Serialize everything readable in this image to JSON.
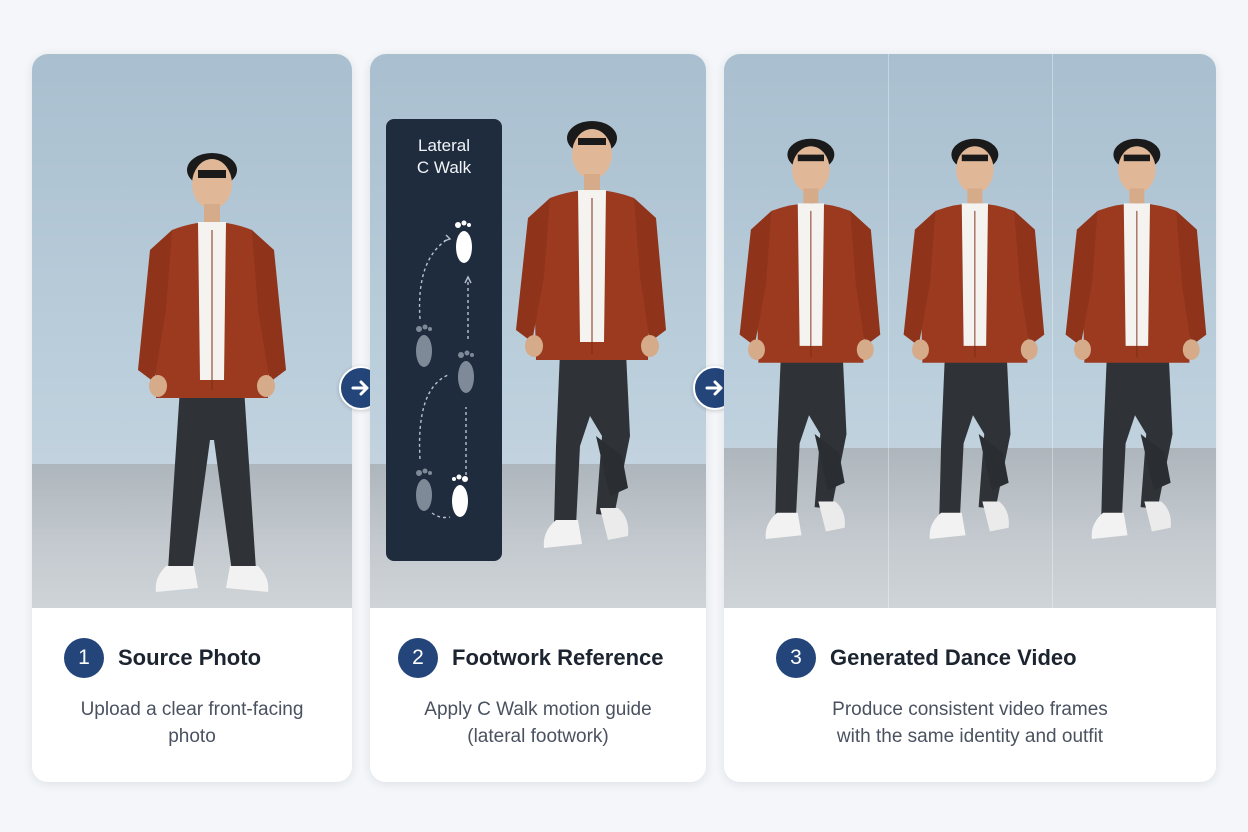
{
  "steps": [
    {
      "number": "1",
      "title": "Source Photo",
      "description": "Upload a clear front-facing photo"
    },
    {
      "number": "2",
      "title": "Footwork Reference",
      "description": "Apply C Walk motion guide (lateral footwork)"
    },
    {
      "number": "3",
      "title": "Generated Dance Video",
      "description": "Produce consistent video frames with the same identity and outfit"
    }
  ],
  "footwork": {
    "title": "Lateral\nC Walk"
  },
  "icons": {
    "flow_arrow": "arrow-right-icon",
    "footprint": "footprint-icon"
  },
  "colors": {
    "accent": "#24457a",
    "shirt": "#9b3a1f",
    "pants": "#2f3338",
    "panel": "#1f2c3e"
  }
}
